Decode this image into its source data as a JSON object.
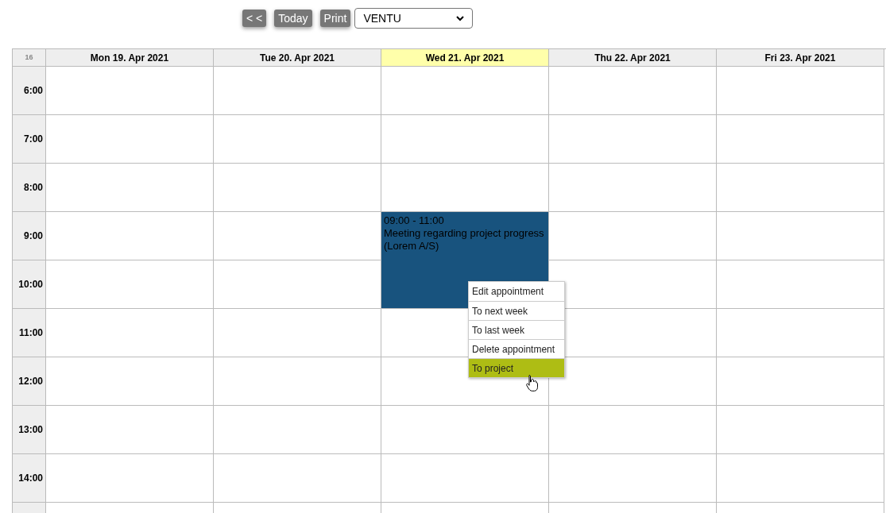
{
  "toolbar": {
    "buttons": [
      "< <",
      "Today",
      "Print"
    ],
    "select": {
      "value": "VENTU"
    }
  },
  "calendar": {
    "week": "16",
    "days": [
      {
        "label": "Mon 19. Apr 2021",
        "selected": false
      },
      {
        "label": "Tue 20. Apr 2021",
        "selected": false
      },
      {
        "label": "Wed 21. Apr 2021",
        "selected": true,
        "events": [
          {
            "time": "09:00 - 11:00",
            "title": "Meeting regarding project progress",
            "company": "(Lorem A/S)",
            "color": "#18537e"
          }
        ]
      },
      {
        "label": "Thu 22. Apr 2021",
        "selected": false
      },
      {
        "label": "Fri 23. Apr 2021",
        "selected": false
      }
    ],
    "hours": [
      "6:00",
      "7:00",
      "8:00",
      "9:00",
      "10:00",
      "11:00",
      "12:00",
      "13:00",
      "14:00"
    ]
  },
  "context_menu": [
    {
      "label": "Edit appointment",
      "selected": false
    },
    {
      "label": "To next week",
      "selected": false
    },
    {
      "label": "To last week",
      "selected": false
    },
    {
      "label": "Delete appointment",
      "selected": false
    },
    {
      "label": "To project",
      "selected": true
    }
  ]
}
